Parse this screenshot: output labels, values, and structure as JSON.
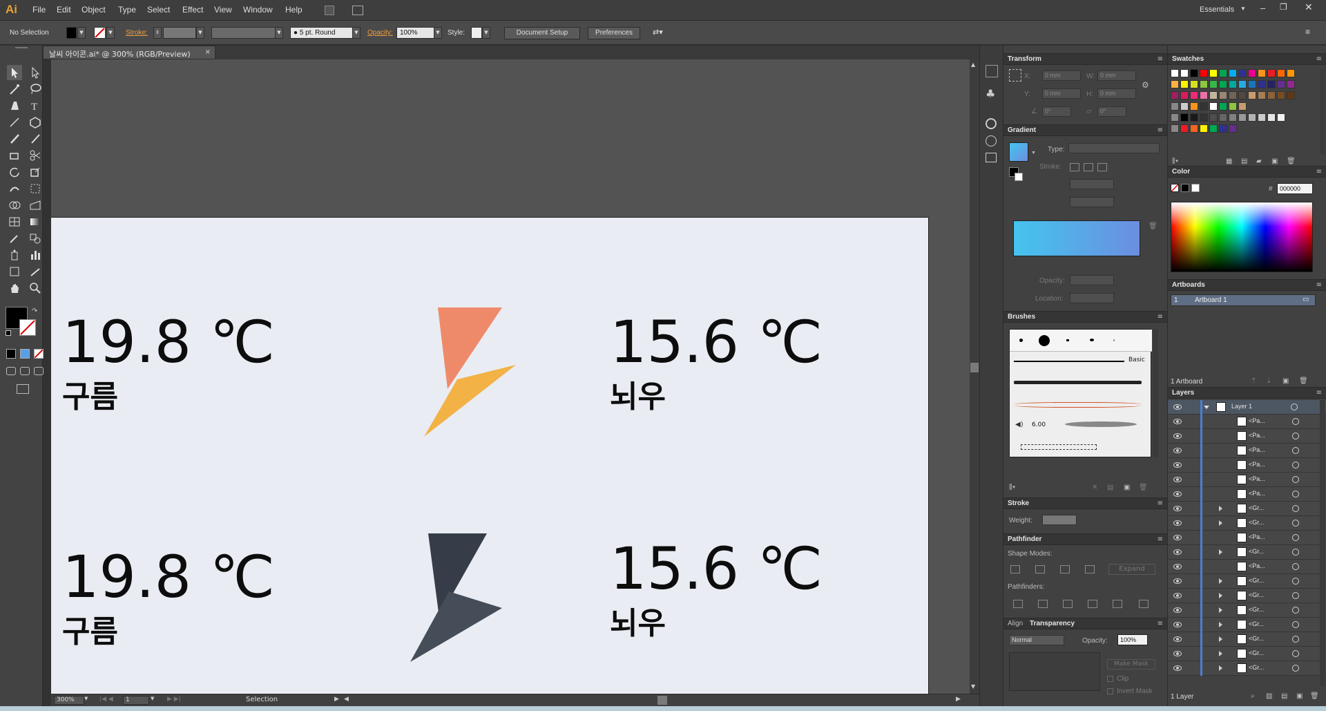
{
  "app": {
    "logo": "Ai",
    "menu": [
      "File",
      "Edit",
      "Object",
      "Type",
      "Select",
      "Effect",
      "View",
      "Window",
      "Help"
    ],
    "workspace": "Essentials"
  },
  "control_bar": {
    "selection_status": "No Selection",
    "stroke_label": "Stroke:",
    "brush_value": "5 pt. Round",
    "opacity_label": "Opacity:",
    "opacity_value": "100%",
    "style_label": "Style:",
    "document_setup": "Document Setup",
    "preferences": "Preferences"
  },
  "document": {
    "tab_title": "날씨 아이콘.ai* @ 300% (RGB/Preview)",
    "zoom": "300%",
    "artboard_number": "1",
    "status_tool": "Selection"
  },
  "artboard_content": {
    "top_left_temp": "19.8 ℃",
    "top_left_cond": "구름",
    "top_right_temp": "15.6 ℃",
    "top_right_cond": "뇌우",
    "bottom_left_temp": "19.8 ℃",
    "bottom_left_cond": "구름",
    "bottom_right_temp": "15.6 ℃",
    "bottom_right_cond": "뇌우",
    "colors": {
      "bolt_top_upper": "#ee8a6a",
      "bolt_top_lower": "#f2b246",
      "bolt_bottom_upper": "#363d49",
      "bolt_bottom_lower": "#454d59",
      "artboard_bg": "#e9ecf2"
    }
  },
  "transform_panel": {
    "title": "Transform",
    "x_label": "X:",
    "x_value": "0 mm",
    "y_label": "Y:",
    "y_value": "0 mm",
    "w_label": "W:",
    "w_value": "0 mm",
    "h_label": "H:",
    "h_value": "0 mm",
    "rotate_value": "0°",
    "shear_value": "0°"
  },
  "gradient_panel": {
    "title": "Gradient",
    "type_label": "Type:",
    "stroke_label": "Stroke:",
    "opacity_label": "Opacity:",
    "location_label": "Location:",
    "colors": {
      "start": "#44c4ee",
      "end": "#6b8ee0"
    }
  },
  "brushes_panel": {
    "title": "Brushes",
    "basic_label": "Basic",
    "size_value": "6.00"
  },
  "stroke_panel": {
    "title": "Stroke",
    "weight_label": "Weight:"
  },
  "pathfinder_panel": {
    "title": "Pathfinder",
    "shape_modes_label": "Shape Modes:",
    "expand_label": "Expand",
    "pathfinders_label": "Pathfinders:"
  },
  "align_tab": "Align",
  "transparency_panel": {
    "title": "Transparency",
    "blend_mode": "Normal",
    "opacity_label": "Opacity:",
    "opacity_value": "100%",
    "make_mask": "Make Mask",
    "clip": "Clip",
    "invert_mask": "Invert Mask"
  },
  "swatches_panel": {
    "title": "Swatches"
  },
  "color_panel": {
    "title": "Color",
    "hex_label": "#",
    "hex_value": "000000"
  },
  "artboards_panel": {
    "title": "Artboards",
    "rows": [
      {
        "index": "1",
        "name": "Artboard 1"
      }
    ],
    "footer": "1 Artboard"
  },
  "layers_panel": {
    "title": "Layers",
    "layer_name": "Layer 1",
    "items": [
      "<Pa...",
      "<Pa...",
      "<Pa...",
      "<Pa...",
      "<Pa...",
      "<Pa...",
      "<Gr...",
      "<Gr...",
      "<Pa...",
      "<Gr...",
      "<Pa...",
      "<Gr...",
      "<Gr...",
      "<Gr...",
      "<Gr...",
      "<Gr...",
      "<Gr...",
      "<Gr..."
    ],
    "footer": "1 Layer"
  }
}
